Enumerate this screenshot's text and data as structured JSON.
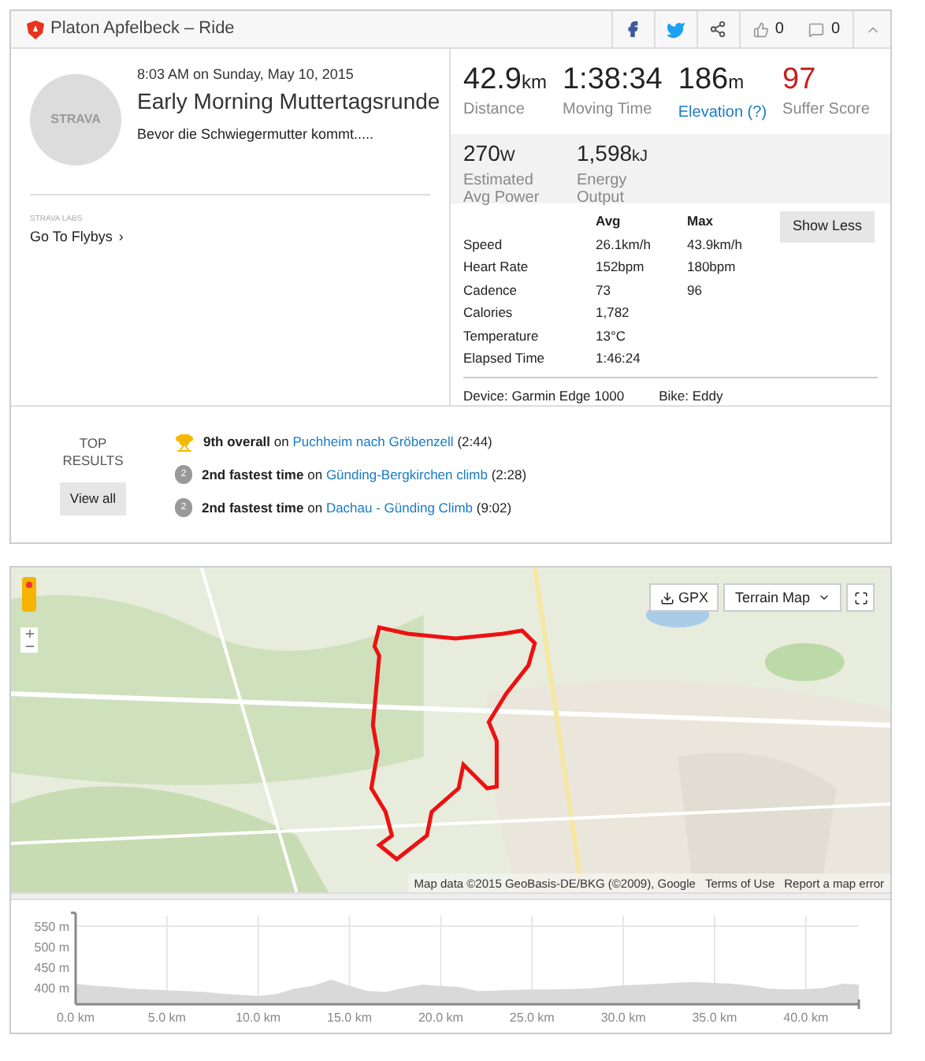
{
  "header": {
    "title": "Platon Apfelbeck – Ride",
    "likes": "0",
    "comments": "0"
  },
  "activity": {
    "avatar_text": "STRAVA",
    "datetime": "8:03 AM on Sunday, May 10, 2015",
    "title": "Early Morning Muttertagsrunde",
    "description": "Bevor die Schwiegermutter kommt.....",
    "labs_label": "STRAVA LABS",
    "flybys_link": "Go To Flybys",
    "flybys_arrow": "›"
  },
  "primary_stats": [
    {
      "value": "42.9",
      "unit": "km",
      "label": "Distance",
      "kind": "plain"
    },
    {
      "value": "1:38:34",
      "label": "Moving Time",
      "kind": "plain"
    },
    {
      "value": "186",
      "unit": "m",
      "label": "Elevation (?)",
      "kind": "link"
    },
    {
      "value": "97",
      "label": "Suffer Score",
      "kind": "score"
    }
  ],
  "secondary_stats": [
    {
      "value": "270",
      "unit": "W",
      "label": "Estimated Avg Power"
    },
    {
      "value": "1,598",
      "unit": "kJ",
      "label": "Energy Output"
    }
  ],
  "details": {
    "headers": [
      "Avg",
      "Max"
    ],
    "button": "Show Less",
    "rows": [
      {
        "label": "Speed",
        "avg": "26.1km/h",
        "max": "43.9km/h"
      },
      {
        "label": "Heart Rate",
        "avg": "152bpm",
        "max": "180bpm"
      },
      {
        "label": "Cadence",
        "avg": "73",
        "max": "96"
      },
      {
        "label": "Calories",
        "avg": "1,782"
      },
      {
        "label": "Temperature",
        "avg": "13°C"
      },
      {
        "label": "Elapsed Time",
        "avg": "1:46:24"
      }
    ],
    "device": "Device: Garmin Edge 1000",
    "bike": "Bike: Eddy"
  },
  "top_results": {
    "title": "TOP RESULTS",
    "button": "View all",
    "items": [
      {
        "kind": "trophy",
        "rank": "9th overall",
        "joiner": "on",
        "segment": "Puchheim nach Gröbenzell",
        "time": "(2:44)"
      },
      {
        "kind": "medal",
        "medal_number": "2",
        "rank": "2nd fastest time",
        "joiner": "on",
        "segment": "Günding-Bergkirchen climb",
        "time": "(2:28)"
      },
      {
        "kind": "medal",
        "medal_number": "2",
        "rank": "2nd fastest time",
        "joiner": "on",
        "segment": "Dachau - Günding Climb",
        "time": "(9:02)"
      }
    ]
  },
  "map": {
    "gpx": "GPX",
    "map_type": "Terrain Map",
    "attribution": "Map data ©2015 GeoBasis-DE/BKG (©2009), Google",
    "terms": "Terms of Use",
    "report": "Report a map error"
  },
  "elevation": {
    "chart_data": {
      "type": "area",
      "x": [
        0,
        1,
        2,
        3,
        4,
        5,
        6,
        7,
        8,
        9,
        10,
        11,
        12,
        13,
        14,
        15,
        16,
        17,
        18,
        19,
        20,
        21,
        22,
        23,
        24,
        25,
        26,
        27,
        28,
        29,
        30,
        31,
        32,
        33,
        34,
        35,
        36,
        37,
        38,
        39,
        40,
        41,
        42,
        42.9
      ],
      "grid": true,
      "series": [
        {
          "color": "#d9d9d9",
          "values": [
            410,
            405,
            402,
            398,
            396,
            394,
            392,
            390,
            386,
            383,
            380,
            385,
            398,
            405,
            420,
            405,
            392,
            390,
            400,
            408,
            404,
            402,
            392,
            393,
            395,
            396,
            396,
            397,
            398,
            402,
            406,
            408,
            410,
            413,
            414,
            412,
            410,
            405,
            398,
            396,
            397,
            400,
            410,
            408
          ]
        }
      ],
      "xlim": [
        0,
        42.9
      ],
      "ylim": [
        360,
        575
      ],
      "xticks": [
        {
          "value": 0,
          "label": "0.0 km"
        },
        {
          "value": 5,
          "label": "5.0 km"
        },
        {
          "value": 10,
          "label": "10.0 km"
        },
        {
          "value": 15,
          "label": "15.0 km"
        },
        {
          "value": 20,
          "label": "20.0 km"
        },
        {
          "value": 25,
          "label": "25.0 km"
        },
        {
          "value": 30,
          "label": "30.0 km"
        },
        {
          "value": 35,
          "label": "35.0 km"
        },
        {
          "value": 40,
          "label": "40.0 km"
        }
      ],
      "yticks": [
        {
          "value": 400,
          "label": "400 m"
        },
        {
          "value": 450,
          "label": "450 m"
        },
        {
          "value": 500,
          "label": "500 m"
        },
        {
          "value": 550,
          "label": "550 m"
        }
      ]
    }
  }
}
